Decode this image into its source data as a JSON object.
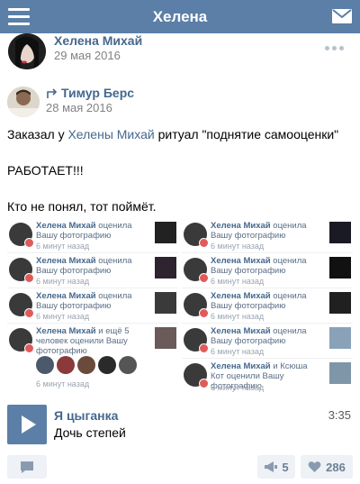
{
  "header": {
    "title": "Хелена"
  },
  "post": {
    "author": "Хелена Михай",
    "date": "29 мая 2016"
  },
  "repost": {
    "author": "Тимур Берс",
    "date": "28 мая 2016"
  },
  "body": {
    "line1_pre": "Заказал у ",
    "line1_link": "Хелены Михай",
    "line1_post": " ритуал \"поднятие самооценки\"",
    "line2": "РАБОТАЕТ!!!",
    "line3": "Кто не понял, тот поймёт."
  },
  "notifications": {
    "left": [
      {
        "name": "Хелена Михай",
        "action": "оценила Вашу фотографию",
        "time": "6 минут назад"
      },
      {
        "name": "Хелена Михай",
        "action": "оценила Вашу фотографию",
        "time": "6 минут назад"
      },
      {
        "name": "Хелена Михай",
        "action": "оценила Вашу фотографию",
        "time": "6 минут назад"
      },
      {
        "name": "Хелена Михай",
        "action": "и ещё 5 человек оценили Вашу фотографию",
        "time": "6 минут назад"
      }
    ],
    "right": [
      {
        "name": "Хелена Михай",
        "action": "оценила Вашу фотографию",
        "time": "6 минут назад"
      },
      {
        "name": "Хелена Михай",
        "action": "оценила Вашу фотографию",
        "time": "6 минут назад"
      },
      {
        "name": "Хелена Михай",
        "action": "оценила Вашу фотографию",
        "time": "6 минут назад"
      },
      {
        "name": "Хелена Михай",
        "action": "оценила Вашу фотографию",
        "time": "6 минут назад"
      },
      {
        "name": "Хелена Михай",
        "action": "и Ксюша Кот оценили Вашу фотографию",
        "time": "6 минут назад"
      }
    ]
  },
  "audio": {
    "artist": "Я цыганка",
    "title": "Дочь степей",
    "duration": "3:35"
  },
  "actions": {
    "shares": "5",
    "likes": "286"
  },
  "colors": {
    "brand": "#5b7fa6",
    "link": "#45688e",
    "heart": "#e15a5a"
  }
}
